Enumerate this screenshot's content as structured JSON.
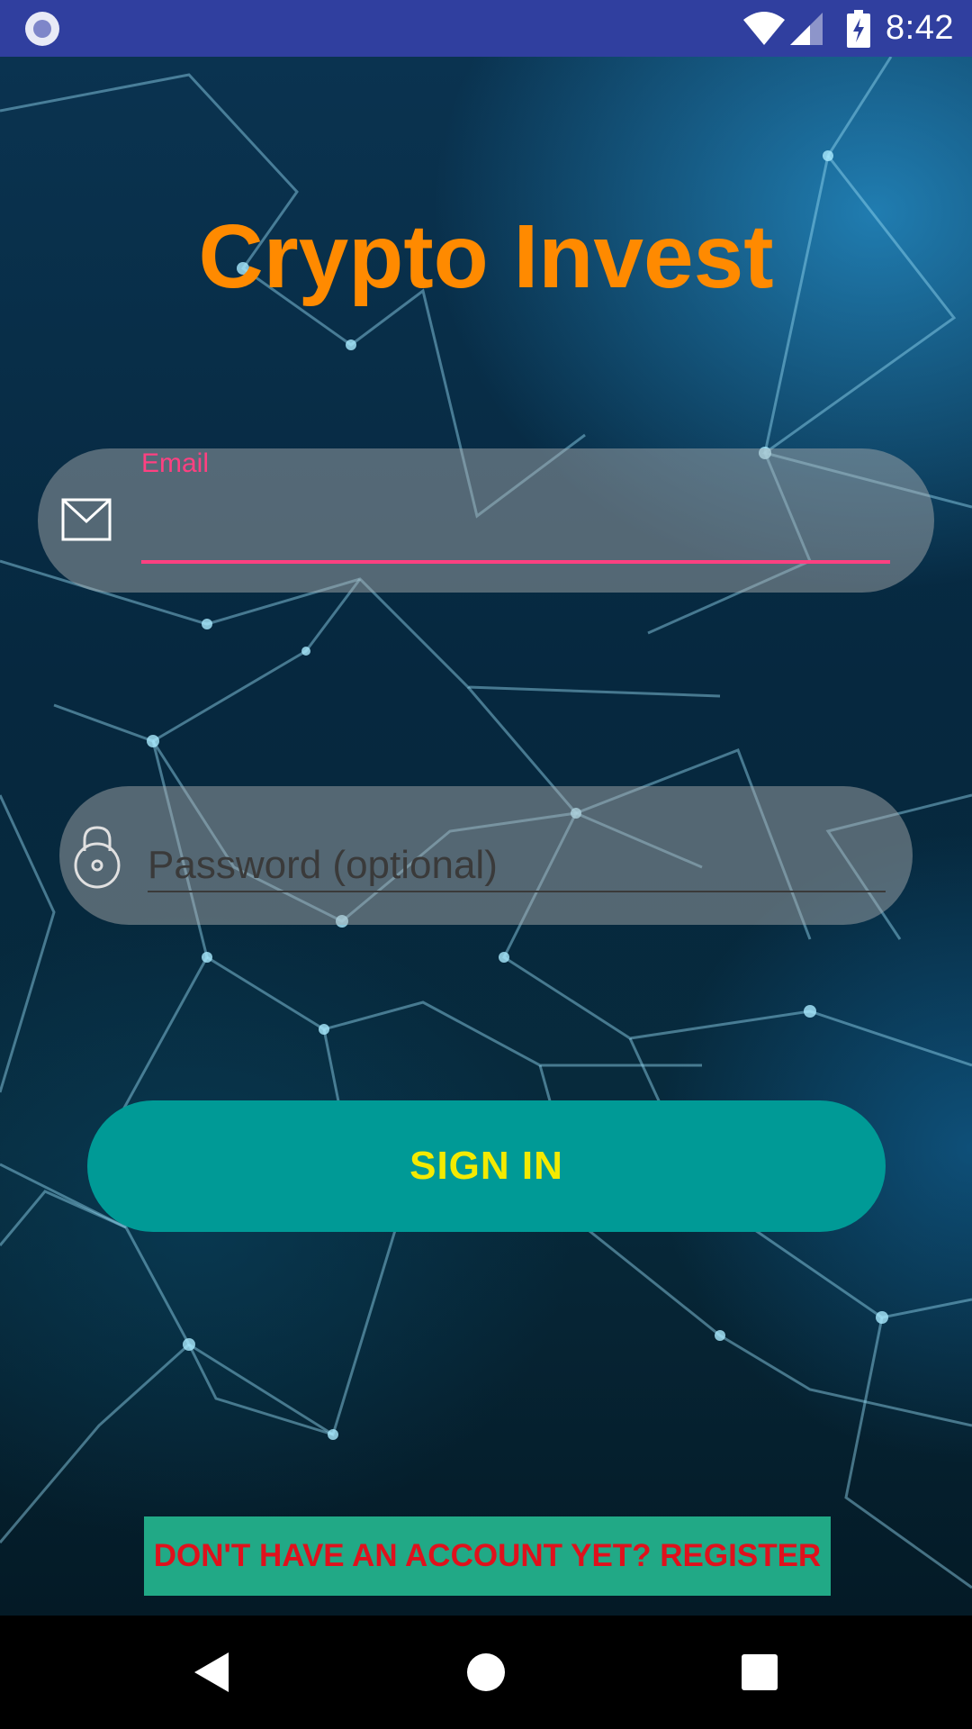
{
  "status_bar": {
    "time": "8:42",
    "icons": [
      "circle-notification-icon",
      "wifi-icon",
      "cell-signal-icon",
      "battery-charging-icon"
    ]
  },
  "app": {
    "title": "Crypto Invest"
  },
  "login_form": {
    "email": {
      "label": "Email",
      "value": "",
      "icon": "envelope-icon"
    },
    "password": {
      "placeholder": "Password (optional)",
      "value": "",
      "icon": "lock-icon"
    },
    "sign_in_label": "SIGN IN",
    "register_label": "DON'T HAVE AN ACCOUNT YET? REGISTER"
  },
  "navigation_bar": {
    "buttons": [
      "back-icon",
      "home-icon",
      "recents-icon"
    ]
  },
  "colors": {
    "status_bar": "#303f9f",
    "title": "#ff8a00",
    "accent_pink": "#ff4081",
    "sign_in_bg": "#009a96",
    "sign_in_text": "#f4ea00",
    "register_bg": "#21a986",
    "register_text": "#e0111c"
  }
}
